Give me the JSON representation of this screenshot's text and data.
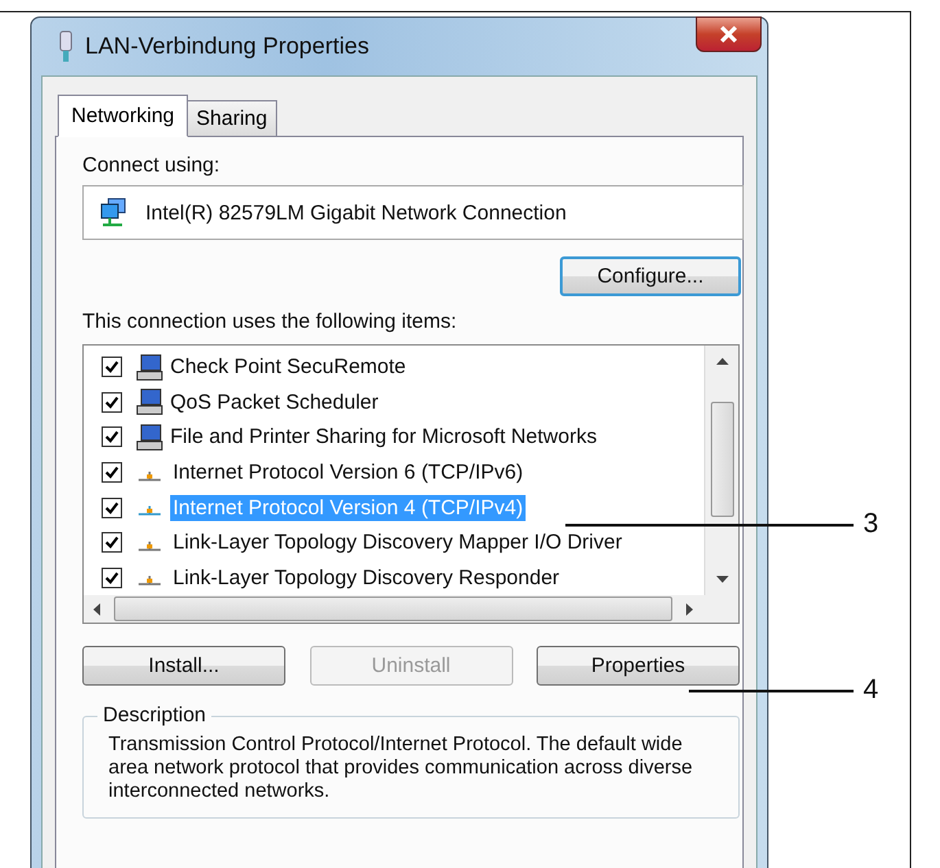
{
  "window": {
    "title": "LAN-Verbindung Properties"
  },
  "tabs": [
    {
      "label": "Networking",
      "selected": true
    },
    {
      "label": "Sharing",
      "selected": false
    }
  ],
  "connect_using": {
    "label": "Connect using:",
    "adapter": "Intel(R) 82579LM Gigabit Network Connection",
    "button": "Configure..."
  },
  "items_label": "This connection uses the following items:",
  "items": [
    {
      "label": "Check Point SecuRemote",
      "kind": "client",
      "checked": true,
      "selected": false
    },
    {
      "label": "QoS Packet Scheduler",
      "kind": "client",
      "checked": true,
      "selected": false
    },
    {
      "label": "File and Printer Sharing for Microsoft Networks",
      "kind": "client",
      "checked": true,
      "selected": false
    },
    {
      "label": "Internet Protocol Version 6 (TCP/IPv6)",
      "kind": "protocol",
      "checked": true,
      "selected": false
    },
    {
      "label": "Internet Protocol Version 4 (TCP/IPv4)",
      "kind": "protocol",
      "checked": true,
      "selected": true
    },
    {
      "label": "Link-Layer Topology Discovery Mapper I/O Driver",
      "kind": "protocol",
      "checked": true,
      "selected": false
    },
    {
      "label": "Link-Layer Topology Discovery Responder",
      "kind": "protocol",
      "checked": true,
      "selected": false
    }
  ],
  "buttons": [
    {
      "label": "Install...",
      "disabled": false
    },
    {
      "label": "Uninstall",
      "disabled": true
    },
    {
      "label": "Properties",
      "disabled": false
    }
  ],
  "description": {
    "title": "Description",
    "text": "Transmission Control Protocol/Internet Protocol. The default wide area network protocol that provides communication across diverse interconnected networks."
  },
  "callouts": [
    {
      "label": "3"
    },
    {
      "label": "4"
    }
  ]
}
